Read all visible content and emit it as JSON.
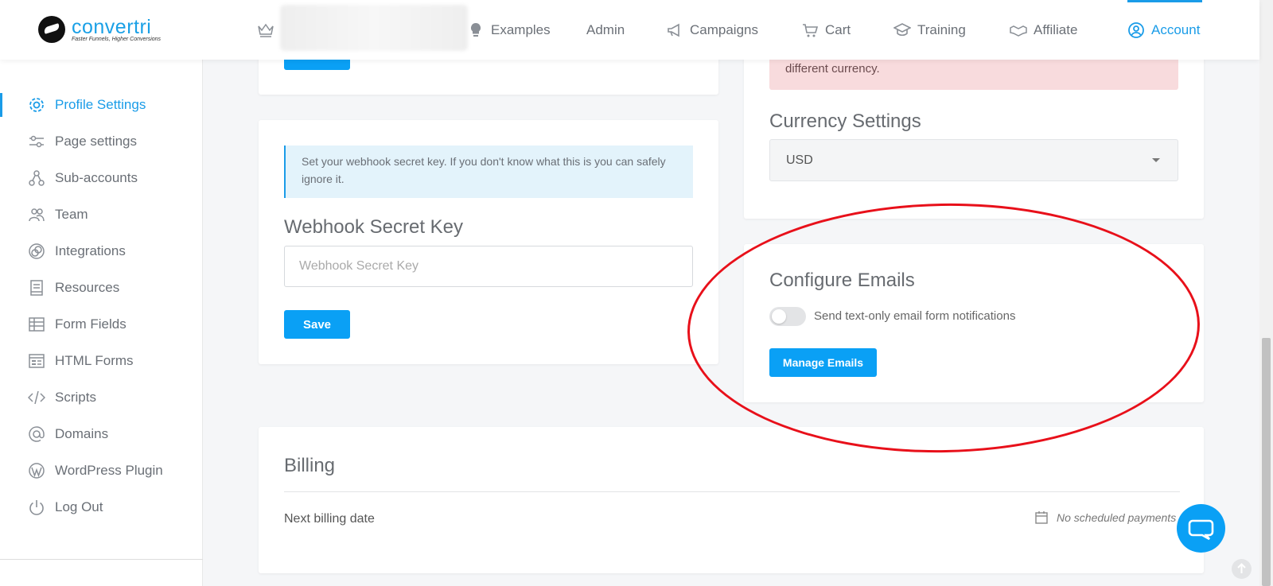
{
  "brand": {
    "name": "convertri",
    "tagline": "Faster Funnels, Higher Conversions"
  },
  "nav": {
    "examples": "Examples",
    "admin": "Admin",
    "campaigns": "Campaigns",
    "cart": "Cart",
    "training": "Training",
    "affiliate": "Affiliate",
    "account": "Account"
  },
  "sidebar": {
    "items": [
      {
        "label": "Profile Settings"
      },
      {
        "label": "Page settings"
      },
      {
        "label": "Sub-accounts"
      },
      {
        "label": "Team"
      },
      {
        "label": "Integrations"
      },
      {
        "label": "Resources"
      },
      {
        "label": "Form Fields"
      },
      {
        "label": "HTML Forms"
      },
      {
        "label": "Scripts"
      },
      {
        "label": "Domains"
      },
      {
        "label": "WordPress Plugin"
      },
      {
        "label": "Log Out"
      }
    ]
  },
  "webhook": {
    "info": "Set your webhook secret key. If you don't know what this is you can safely ignore it.",
    "title": "Webhook Secret Key",
    "placeholder": "Webhook Secret Key",
    "save_label": "Save"
  },
  "currency": {
    "alert_tail": "different currency.",
    "title": "Currency Settings",
    "selected": "USD"
  },
  "emails": {
    "title": "Configure Emails",
    "toggle_label": "Send text-only email form notifications",
    "toggle_on": false,
    "manage_label": "Manage Emails"
  },
  "billing": {
    "title": "Billing",
    "next_label": "Next billing date",
    "next_value": "No scheduled payments"
  },
  "colors": {
    "accent": "#0aa0f5",
    "annotation": "#e8101a"
  }
}
